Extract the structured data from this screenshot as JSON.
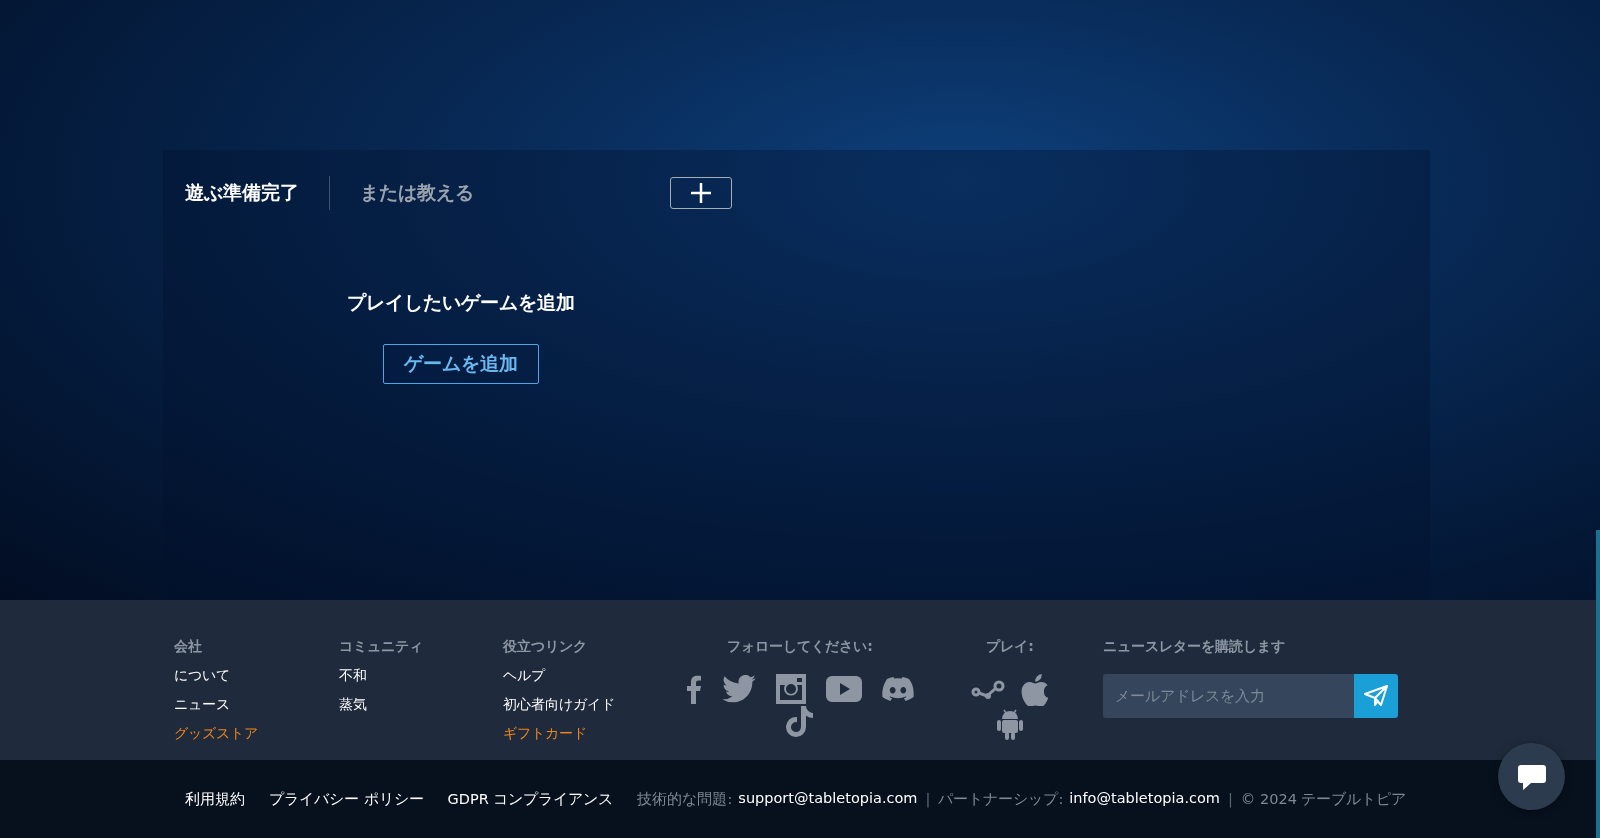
{
  "tabs": [
    {
      "label": "遊ぶ準備完了",
      "selected": true
    },
    {
      "label": "または教える",
      "selected": false
    }
  ],
  "empty_state": {
    "message": "プレイしたいゲームを追加",
    "button": "ゲームを追加"
  },
  "footer": {
    "columns": [
      {
        "heading": "会社",
        "links": [
          {
            "label": "について",
            "highlighted": false
          },
          {
            "label": "ニュース",
            "highlighted": false
          },
          {
            "label": "グッズストア",
            "highlighted": true
          }
        ]
      },
      {
        "heading": "コミュニティ",
        "links": [
          {
            "label": "不和",
            "highlighted": false
          },
          {
            "label": "蒸気",
            "highlighted": false
          }
        ]
      },
      {
        "heading": "役立つリンク",
        "links": [
          {
            "label": "ヘルプ",
            "highlighted": false
          },
          {
            "label": "初心者向けガイド",
            "highlighted": false
          },
          {
            "label": "ギフトカード",
            "highlighted": true
          }
        ]
      }
    ],
    "follow": {
      "heading": "フォローしてください:"
    },
    "play": {
      "heading": "プレイ:"
    },
    "newsletter": {
      "heading": "ニュースレターを購読します",
      "placeholder": "メールアドレスを入力"
    }
  },
  "bottom_bar": [
    {
      "kind": "link",
      "label": "利用規約"
    },
    {
      "kind": "link",
      "label": "プライバシー ポリシー"
    },
    {
      "kind": "link",
      "label": "GDPR コンプライアンス"
    },
    {
      "kind": "contact",
      "label": "技術的な問題:",
      "email": "support@tabletopia.com"
    },
    {
      "kind": "separator",
      "label": "|"
    },
    {
      "kind": "contact",
      "label": "パートナーシップ:",
      "email": "info@tabletopia.com"
    },
    {
      "kind": "separator",
      "label": "|"
    },
    {
      "kind": "copyright",
      "label": "© 2024 テーブルトピア"
    }
  ]
}
